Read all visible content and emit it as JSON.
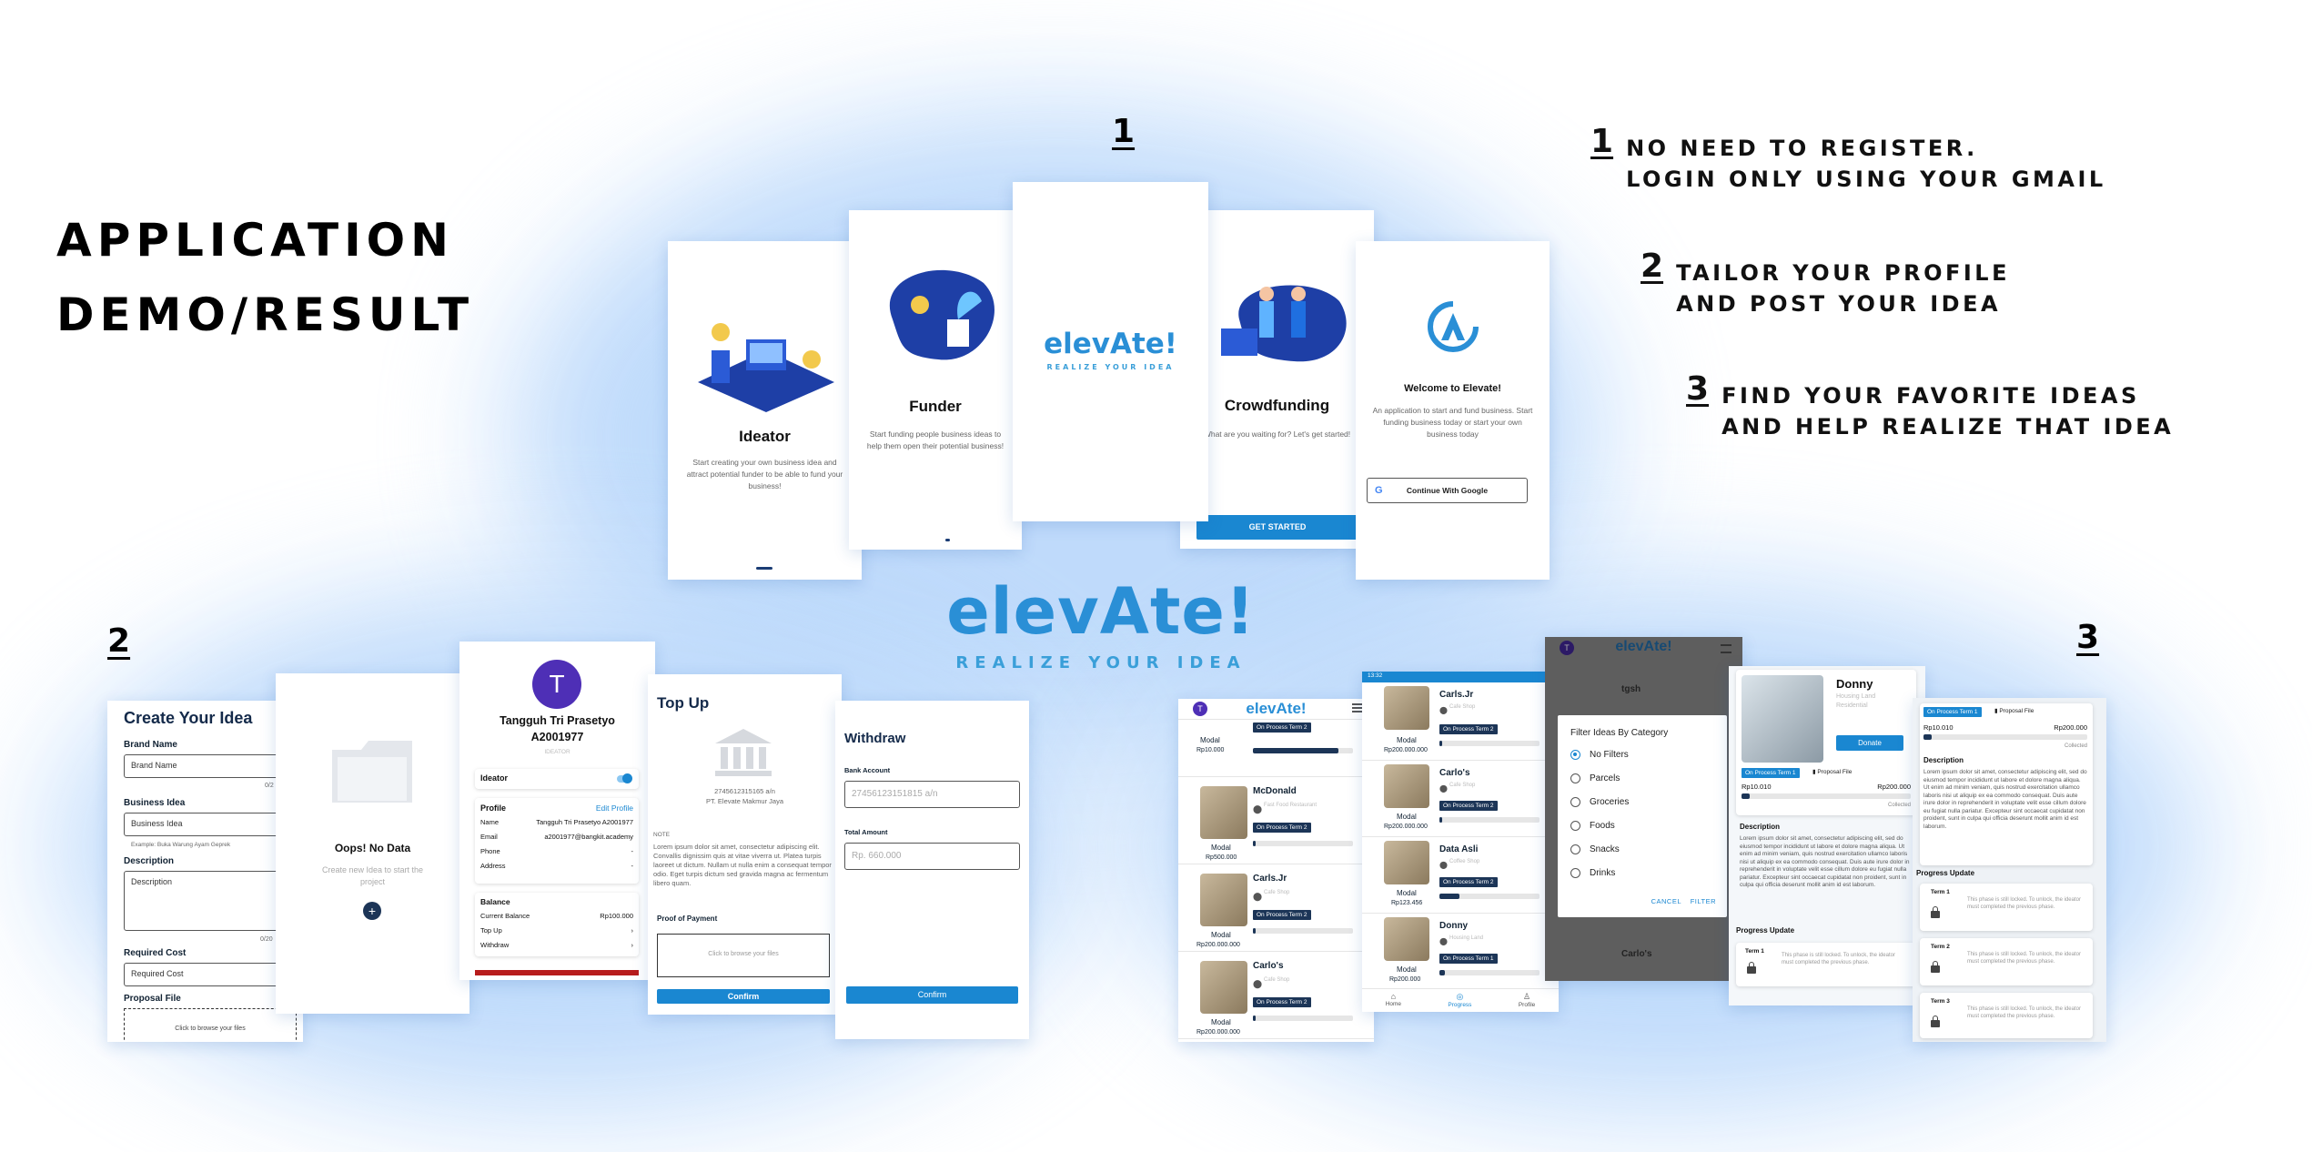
{
  "heading": {
    "line1": "APPLICATION",
    "line2": "DEMO/RESULT"
  },
  "section_numbers": {
    "one": "1",
    "two": "2",
    "three": "3"
  },
  "steps": [
    {
      "num": "1",
      "text": "NO NEED TO REGISTER.\nLOGIN ONLY USING YOUR GMAIL"
    },
    {
      "num": "2",
      "text": "TAILOR YOUR PROFILE\nAND POST YOUR IDEA"
    },
    {
      "num": "3",
      "text": "FIND YOUR FAVORITE IDEAS\nAND HELP REALIZE THAT IDEA"
    }
  ],
  "brand": {
    "name": "elevAte!",
    "tagline": "REALIZE YOUR IDEA"
  },
  "onboarding": {
    "ideator": {
      "title": "Ideator",
      "desc": "Start creating your own business idea and attract potential funder to be able to fund your business!"
    },
    "funder": {
      "title": "Funder",
      "desc": "Start funding people business ideas to help them open their potential business!"
    },
    "crowdfunding": {
      "title": "Crowdfunding",
      "desc": "What are you waiting for? Let's get started!",
      "button": "GET STARTED"
    },
    "welcome": {
      "title": "Welcome to Elevate!",
      "desc": "An application to start and fund business. Start funding business today or start your own business today",
      "google_button": "Continue With Google"
    }
  },
  "create_idea": {
    "title": "Create Your Idea",
    "brand_label": "Brand Name",
    "brand_placeholder": "Brand Name",
    "brand_count": "0/2",
    "idea_label": "Business Idea",
    "idea_placeholder": "Business Idea",
    "idea_hint": "Example: Buka Warung Ayam Geprek",
    "desc_label": "Description",
    "desc_placeholder": "Description",
    "desc_count": "0/20",
    "cost_label": "Required Cost",
    "cost_placeholder": "Required Cost",
    "file_label": "Proposal File",
    "file_hint": "Click to browse your files"
  },
  "no_data": {
    "title": "Oops! No Data",
    "desc": "Create new Idea to start the project",
    "add": "+"
  },
  "profile": {
    "avatar_letter": "T",
    "name": "Tangguh Tri Prasetyo",
    "id": "A2001977",
    "role": "IDEATOR",
    "ideator_label": "Ideator",
    "profile_label": "Profile",
    "edit_label": "Edit Profile",
    "fields": [
      {
        "k": "Name",
        "v": "Tangguh Tri Prasetyo A2001977"
      },
      {
        "k": "Email",
        "v": "a2001977@bangkit.academy"
      },
      {
        "k": "Phone",
        "v": "-"
      },
      {
        "k": "Address",
        "v": "-"
      }
    ],
    "balance_label": "Balance",
    "current_balance_label": "Current Balance",
    "current_balance": "Rp100.000",
    "top_up": "Top Up",
    "withdraw": "Withdraw"
  },
  "top_up": {
    "title": "Top Up",
    "account": "2745612315165 a/n",
    "account_name": "PT. Elevate Makmur Jaya",
    "note_label": "NOTE",
    "note": "Lorem ipsum dolor sit amet, consectetur adipiscing elit. Convallis dignissim quis at vitae viverra ut. Platea turpis laoreet ut dictum. Nullam ut nulla enim a consequat tempor odio. Eget turpis dictum sed gravida magna ac fermentum libero quam.",
    "proof_label": "Proof of Payment",
    "proof_hint": "Click to browse your files",
    "confirm": "Confirm"
  },
  "withdraw": {
    "title": "Withdraw",
    "bank_label": "Bank Account",
    "bank_placeholder": "27456123151815 a/n",
    "amount_label": "Total Amount",
    "amount_placeholder": "Rp. 660.000",
    "confirm": "Confirm"
  },
  "list_a": {
    "logo": "elevAte!",
    "avatar": "T",
    "items": [
      {
        "name": "",
        "modal_label": "Modal",
        "modal": "Rp10.000",
        "badge": "On Process Term 2",
        "progress": 0.85
      },
      {
        "name": "McDonald",
        "modal_label": "Modal",
        "modal": "Rp500.000",
        "sub": "Fast Food Restaurant",
        "badge": "On Process Term 2",
        "progress": 0.03
      },
      {
        "name": "Carls.Jr",
        "modal_label": "Modal",
        "modal": "Rp200.000.000",
        "sub": "Cafe Shop",
        "badge": "On Process Term 2",
        "progress": 0.03
      },
      {
        "name": "Carlo's",
        "modal_label": "Modal",
        "modal": "Rp200.000.000",
        "sub": "Cafe Shop",
        "badge": "On Process Term 2",
        "progress": 0.03
      }
    ]
  },
  "list_b": {
    "status_time": "13:32",
    "items": [
      {
        "name": "Carls.Jr",
        "sub": "Cafe Shop",
        "modal_label": "Modal",
        "modal": "Rp200.000.000",
        "badge": "On Process Term 2",
        "progress": 0.03
      },
      {
        "name": "Carlo's",
        "sub": "Cafe Shop",
        "modal_label": "Modal",
        "modal": "Rp200.000.000",
        "badge": "On Process Term 2",
        "progress": 0.03
      },
      {
        "name": "Data Asli",
        "sub": "Coffee Shop",
        "modal_label": "Modal",
        "modal": "Rp123.456",
        "badge": "On Process Term 2",
        "progress": 0.2
      },
      {
        "name": "Donny",
        "sub": "Housing Land",
        "modal_label": "Modal",
        "modal": "Rp200.000",
        "badge": "On Process Term 1",
        "progress": 0.05
      }
    ],
    "nav": [
      "Home",
      "Progress",
      "Profile"
    ]
  },
  "filter": {
    "logo": "elevAte!",
    "avatar": "T",
    "bg_item_top": "tgsh",
    "bg_item_bottom": "Carlo's",
    "title": "Filter Ideas By Category",
    "options": [
      "No Filters",
      "Parcels",
      "Groceries",
      "Foods",
      "Snacks",
      "Drinks"
    ],
    "selected": "No Filters",
    "cancel": "CANCEL",
    "apply": "FILTER"
  },
  "detail": {
    "name": "Donny",
    "category": "Housing Land",
    "sub": "Residential",
    "donate": "Donate",
    "badge": "On Process Term 1",
    "proposal": "Proposal File",
    "raised": "Rp10.010",
    "goal": "Rp200.000",
    "collected": "Collected",
    "progress": 0.05,
    "desc_label": "Description",
    "desc": "Lorem ipsum dolor sit amet, consectetur adipiscing elit, sed do eiusmod tempor incididunt ut labore et dolore magna aliqua. Ut enim ad minim veniam, quis nostrud exercitation ullamco laboris nisi ut aliquip ex ea commodo consequat. Duis aute irure dolor in reprehenderit in voluptate velit esse cillum dolore eu fugiat nulla pariatur. Excepteur sint occaecat cupidatat non proident, sunt in culpa qui officia deserunt mollit anim id est laborum.",
    "progress_label": "Progress Update",
    "term1": "Term 1",
    "locked_msg": "This phase is still locked. To unlock, the ideator must completed the previous phase."
  },
  "detail2": {
    "badge": "On Process Term 1",
    "proposal": "Proposal File",
    "raised": "Rp10.010",
    "goal": "Rp200.000",
    "collected": "Collected",
    "progress": 0.05,
    "desc_label": "Description",
    "desc": "Lorem ipsum dolor sit amet, consectetur adipiscing elit, sed do eiusmod tempor incididunt ut labore et dolore magna aliqua. Ut enim ad minim veniam, quis nostrud exercitation ullamco laboris nisi ut aliquip ex ea commodo consequat. Duis aute irure dolor in reprehenderit in voluptate velit esse cillum dolore eu fugiat nulla pariatur. Excepteur sint occaecat cupidatat non proident, sunt in culpa qui officia deserunt mollit anim id est laborum.",
    "progress_label": "Progress Update",
    "terms": [
      "Term 1",
      "Term 2",
      "Term 3"
    ],
    "locked_msg": "This phase is still locked. To unlock, the ideator must completed the previous phase."
  },
  "colors": {
    "brand_blue": "#2a8fd6",
    "navy": "#1c3557",
    "accent": "#1a87d1",
    "glow": "#bcd9fb"
  }
}
